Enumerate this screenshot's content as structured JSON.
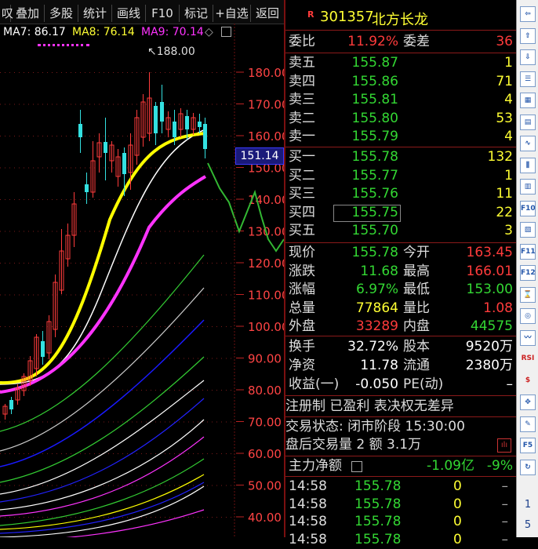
{
  "toolbar": {
    "items": [
      "叹",
      "叠加",
      "多股",
      "统计",
      "画线",
      "F10",
      "标记",
      "+自选",
      "返回"
    ]
  },
  "ma": {
    "ma7_label": "MA7: 86.17",
    "ma8_label": "MA8: 76.14",
    "ma9_label": "MA9: 70.14"
  },
  "chart": {
    "price_axis": [
      "180.00",
      "170.00",
      "160.00",
      "150.00",
      "140.00",
      "130.00",
      "120.00",
      "110.00",
      "100.00",
      "90.00",
      "80.00",
      "70.00",
      "60.00",
      "50.00",
      "40.00"
    ],
    "high_label": "188.00",
    "current_price_label": "151.14"
  },
  "colors": {
    "up": "#ff3b3b",
    "down": "#33e0e0",
    "ma7": "#ffffff",
    "ma8": "#ffff00",
    "ma9": "#ff33ff",
    "accent_border": "#8b1a1a"
  },
  "stock": {
    "badge": "R",
    "code": "301357",
    "name": "北方长龙"
  },
  "order": {
    "webi_label": "委比",
    "webi_value": "11.92%",
    "weicha_label": "委差",
    "weicha_value": "36"
  },
  "asks": [
    {
      "label": "卖五",
      "price": "155.87",
      "vol": "1"
    },
    {
      "label": "卖四",
      "price": "155.86",
      "vol": "71"
    },
    {
      "label": "卖三",
      "price": "155.81",
      "vol": "4"
    },
    {
      "label": "卖二",
      "price": "155.80",
      "vol": "53"
    },
    {
      "label": "卖一",
      "price": "155.79",
      "vol": "4"
    }
  ],
  "bids": [
    {
      "label": "买一",
      "price": "155.78",
      "vol": "132"
    },
    {
      "label": "买二",
      "price": "155.77",
      "vol": "1"
    },
    {
      "label": "买三",
      "price": "155.76",
      "vol": "11"
    },
    {
      "label": "买四",
      "price": "155.75",
      "vol": "22"
    },
    {
      "label": "买五",
      "price": "155.70",
      "vol": "3"
    }
  ],
  "quote": [
    {
      "l1": "现价",
      "v1": "155.78",
      "l2": "今开",
      "v2": "163.45"
    },
    {
      "l1": "涨跌",
      "v1": "11.68",
      "l2": "最高",
      "v2": "166.01"
    },
    {
      "l1": "涨幅",
      "v1": "6.97%",
      "l2": "最低",
      "v2": "153.00"
    },
    {
      "l1": "总量",
      "v1": "77864",
      "l2": "量比",
      "v2": "1.08"
    },
    {
      "l1": "外盘",
      "v1": "33289",
      "l2": "内盘",
      "v2": "44575"
    }
  ],
  "fund": [
    {
      "l1": "换手",
      "v1": "32.72%",
      "l2": "股本",
      "v2": "9520万"
    },
    {
      "l1": "净资",
      "v1": "11.78",
      "l2": "流通",
      "v2": "2380万"
    },
    {
      "l1": "收益(一)",
      "v1": "-0.050",
      "l2": "PE(动)",
      "v2": "–"
    }
  ],
  "info": {
    "tags": "注册制 已盈利 表决权无差异",
    "status": "交易状态: 闭市阶段 15:30:00",
    "after": "盘后交易量 2 额 3.1万"
  },
  "flow": {
    "label": "主力净额",
    "value": "-1.09亿",
    "pct": "-9%"
  },
  "ticks": [
    {
      "time": "14:58",
      "price": "155.78",
      "vol": "0",
      "dir": "–"
    },
    {
      "time": "14:58",
      "price": "155.78",
      "vol": "0",
      "dir": "–"
    },
    {
      "time": "14:58",
      "price": "155.78",
      "vol": "0",
      "dir": "–"
    },
    {
      "time": "14:58",
      "price": "155.78",
      "vol": "0",
      "dir": "–"
    }
  ],
  "sidebar": {
    "icons": [
      "left-arrow-icon",
      "up-arrow-icon",
      "down-arrow-icon",
      "list-icon",
      "grid-icon",
      "kline-icon",
      "line-chart-icon",
      "candle-icon",
      "table-icon",
      "f10-icon",
      "news-icon",
      "f11-icon",
      "f12-icon",
      "history-icon",
      "circle-icon",
      "wave-icon",
      "rsi-icon",
      "dollar-icon",
      "move-icon",
      "pencil-icon",
      "f5-icon",
      "refresh-icon"
    ],
    "numbers": [
      "1",
      "5"
    ]
  }
}
